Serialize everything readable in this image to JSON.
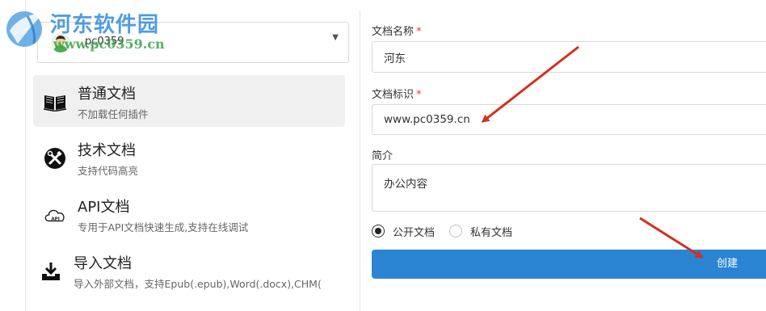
{
  "watermark": {
    "title": "河东软件园",
    "url": "www.pc0359.cn"
  },
  "project_select": {
    "value": "pc0359"
  },
  "doc_types": [
    {
      "title": "普通文档",
      "desc": "不加载任何插件",
      "icon": "book-icon"
    },
    {
      "title": "技术文档",
      "desc": "支持代码高亮",
      "icon": "tools-icon"
    },
    {
      "title": "API文档",
      "desc": "专用于API文档快速生成,支持在线调试",
      "icon": "api-cloud-icon"
    },
    {
      "title": "导入文档",
      "desc": "导入外部文档，支持Epub(.epub),Word(.docx),CHM(",
      "icon": "download-tray-icon"
    }
  ],
  "form": {
    "name_label": "文档名称",
    "name_value": "河东",
    "identifier_label": "文档标识",
    "identifier_value": "www.pc0359.cn",
    "intro_label": "简介",
    "intro_value": "办公内容",
    "required_mark": "*",
    "visibility": {
      "public_label": "公开文档",
      "private_label": "私有文档",
      "selected": "public"
    },
    "create_label": "创建"
  },
  "colors": {
    "primary_button": "#2a84d2",
    "required": "#e53935",
    "annotation_arrow": "#d62d20",
    "active_item_bg": "#f0f0f0"
  }
}
